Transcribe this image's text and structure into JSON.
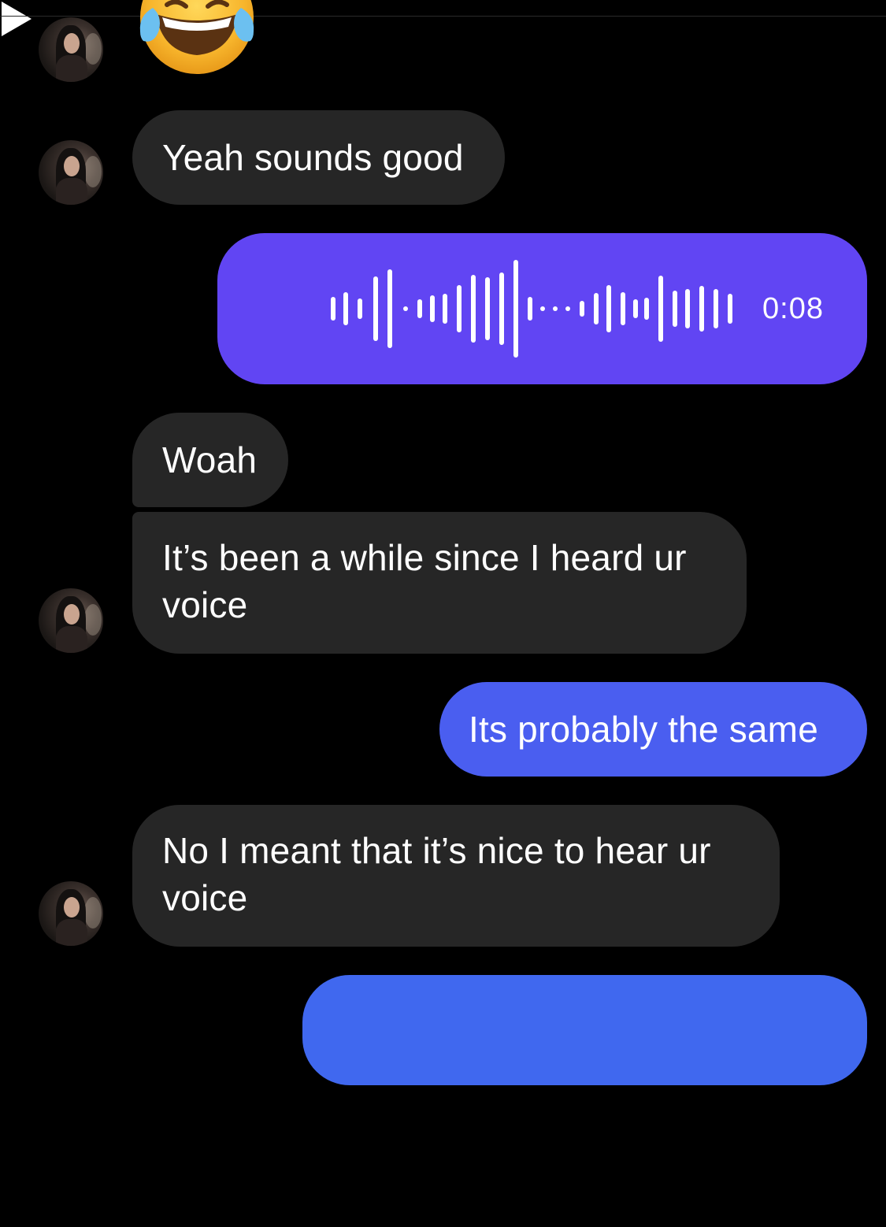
{
  "conversation": {
    "messages": [
      {
        "id": "m1",
        "sender": "other",
        "kind": "emoji",
        "icon": "face-with-tears-of-joy-emoji"
      },
      {
        "id": "m2",
        "sender": "other",
        "kind": "text",
        "text": "Yeah sounds good"
      },
      {
        "id": "m3",
        "sender": "me",
        "kind": "voice",
        "duration": "0:08",
        "icon": "play-icon"
      },
      {
        "id": "m4",
        "sender": "other",
        "kind": "text",
        "text": "Woah"
      },
      {
        "id": "m5",
        "sender": "other",
        "kind": "text",
        "text": "It’s been a while since I heard ur voice"
      },
      {
        "id": "m6",
        "sender": "me",
        "kind": "text",
        "text": "Its probably the same"
      },
      {
        "id": "m7",
        "sender": "other",
        "kind": "text",
        "text": "No I meant that it’s nice to hear ur voice"
      },
      {
        "id": "m8",
        "sender": "me",
        "kind": "voice",
        "duration": "",
        "icon": "waveform-icon"
      }
    ]
  },
  "colors": {
    "background": "#000000",
    "incoming_bubble": "#262626",
    "outgoing_voice_bubble": "#6145f3",
    "outgoing_text_bubble": "#4a5ef0",
    "outgoing_bottom_bubble": "#4068ef",
    "text": "#ffffff"
  }
}
